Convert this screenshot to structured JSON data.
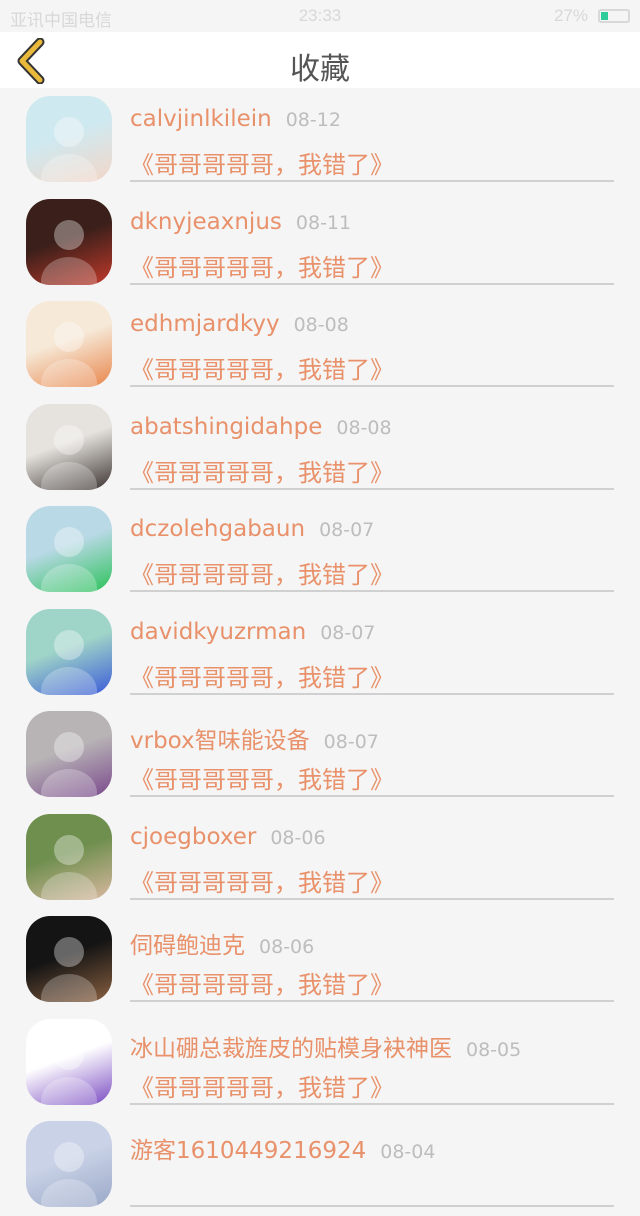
{
  "status_bar": {
    "carrier": "亚讯中国电信",
    "time": "23:33",
    "battery": "27%",
    "battery_color": "#2ecc9a"
  },
  "header": {
    "title": "收藏",
    "back_icon": "chevron-left-icon",
    "accent": "#e8b93a"
  },
  "items": [
    {
      "name": "calvjinlkilein",
      "date": "08-12",
      "message": "《哥哥哥哥哥，我错了》",
      "avatar": "couple-photo",
      "avatar_colors": [
        "#cfe9f0",
        "#f3d6c8"
      ]
    },
    {
      "name": "dknyjeaxnjus",
      "date": "08-11",
      "message": "《哥哥哥哥哥，我错了》",
      "avatar": "girl-red-dress",
      "avatar_colors": [
        "#3a1f1a",
        "#c23a2b"
      ]
    },
    {
      "name": "edhmjardkyy",
      "date": "08-08",
      "message": "《哥哥哥哥哥，我错了》",
      "avatar": "bear-dolls",
      "avatar_colors": [
        "#f6e9d8",
        "#e8854a"
      ]
    },
    {
      "name": "abatshingidahpe",
      "date": "08-08",
      "message": "《哥哥哥哥哥，我错了》",
      "avatar": "boy-portrait",
      "avatar_colors": [
        "#e6e3de",
        "#3b3330"
      ]
    },
    {
      "name": "dczolehgabaun",
      "date": "08-07",
      "message": "《哥哥哥哥哥，我错了》",
      "avatar": "girl-selfie",
      "avatar_colors": [
        "#b9d9e6",
        "#2cc25a"
      ]
    },
    {
      "name": "davidkyuzrman",
      "date": "08-07",
      "message": "《哥哥哥哥哥，我错了》",
      "avatar": "girl-swing",
      "avatar_colors": [
        "#9fd4c8",
        "#3a5bd8"
      ]
    },
    {
      "name": "vrbox智味能设备",
      "date": "08-07",
      "message": "《哥哥哥哥哥，我错了》",
      "avatar": "books",
      "avatar_colors": [
        "#b8b4b6",
        "#7a4a8c"
      ]
    },
    {
      "name": "cjoegboxer",
      "date": "08-06",
      "message": "《哥哥哥哥哥，我错了》",
      "avatar": "girl-hat",
      "avatar_colors": [
        "#6f8f4e",
        "#d9b8a0"
      ]
    },
    {
      "name": "伺碍鲍迪克",
      "date": "08-06",
      "message": "《哥哥哥哥哥，我错了》",
      "avatar": "dark-portrait",
      "avatar_colors": [
        "#141414",
        "#8a6040"
      ]
    },
    {
      "name": "冰山硼总裁旌皮的贴模身袂神医",
      "date": "08-05",
      "message": "《哥哥哥哥哥，我错了》",
      "avatar": "cartoon-girl",
      "avatar_colors": [
        "#ffffff",
        "#7a4cc2"
      ]
    },
    {
      "name": "游客1610449216924",
      "date": "08-04",
      "message": "",
      "avatar": "placeholder",
      "avatar_colors": [
        "#c9d2e6",
        "#9aa8c8"
      ]
    }
  ]
}
